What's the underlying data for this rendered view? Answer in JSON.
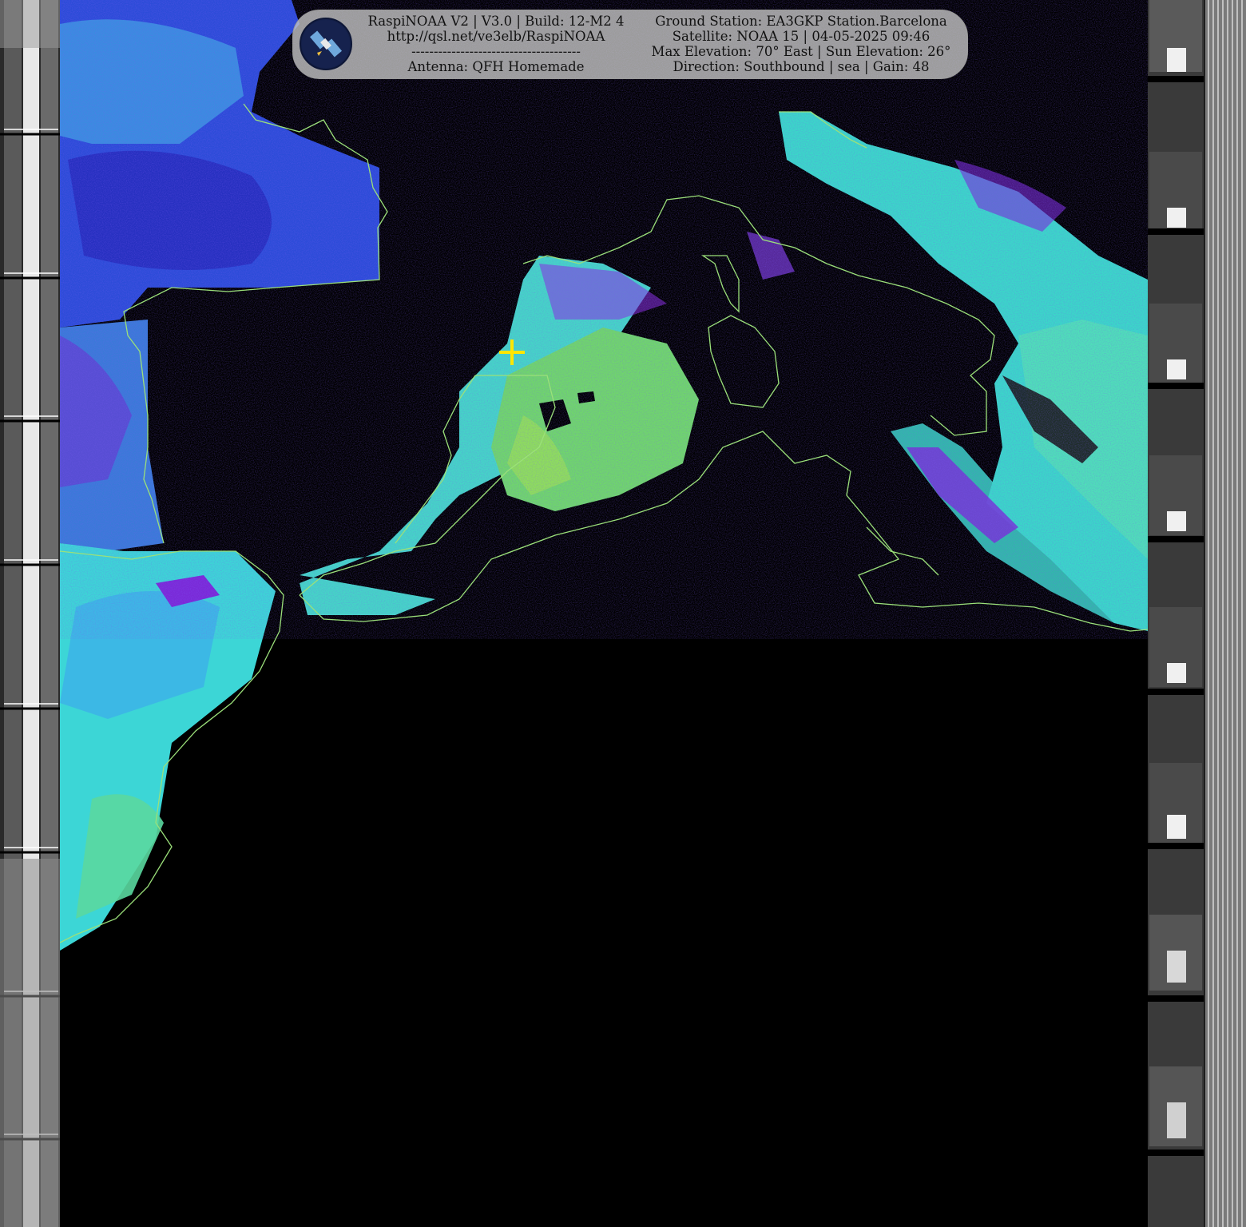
{
  "header": {
    "left_lines": [
      "RaspiNOAA V2 | V3.0 | Build: 12-M2 4",
      "http://qsl.net/ve3elb/RaspiNOAA",
      "--------------------------------------",
      "Antenna: QFH Homemade"
    ],
    "right_lines": [
      "Ground Station: EA3GKP Station.Barcelona",
      "Satellite: NOAA 15 | 04-05-2025 09:46",
      "Max Elevation: 70° East | Sun Elevation: 26°",
      "Direction: Southbound | sea | Gain: 48"
    ]
  },
  "icons": {
    "logo": "satellite-icon",
    "marker": "crosshair-icon"
  },
  "colors": {
    "panel": "#c8c8c8",
    "coastline": "#9be07a",
    "marker": "#ffe600",
    "cloud_high": "#4de0d0",
    "cloud_mid": "#6fd86a",
    "cloud_low": "#3a3ad8",
    "cloud_edge": "#8a2be2"
  }
}
